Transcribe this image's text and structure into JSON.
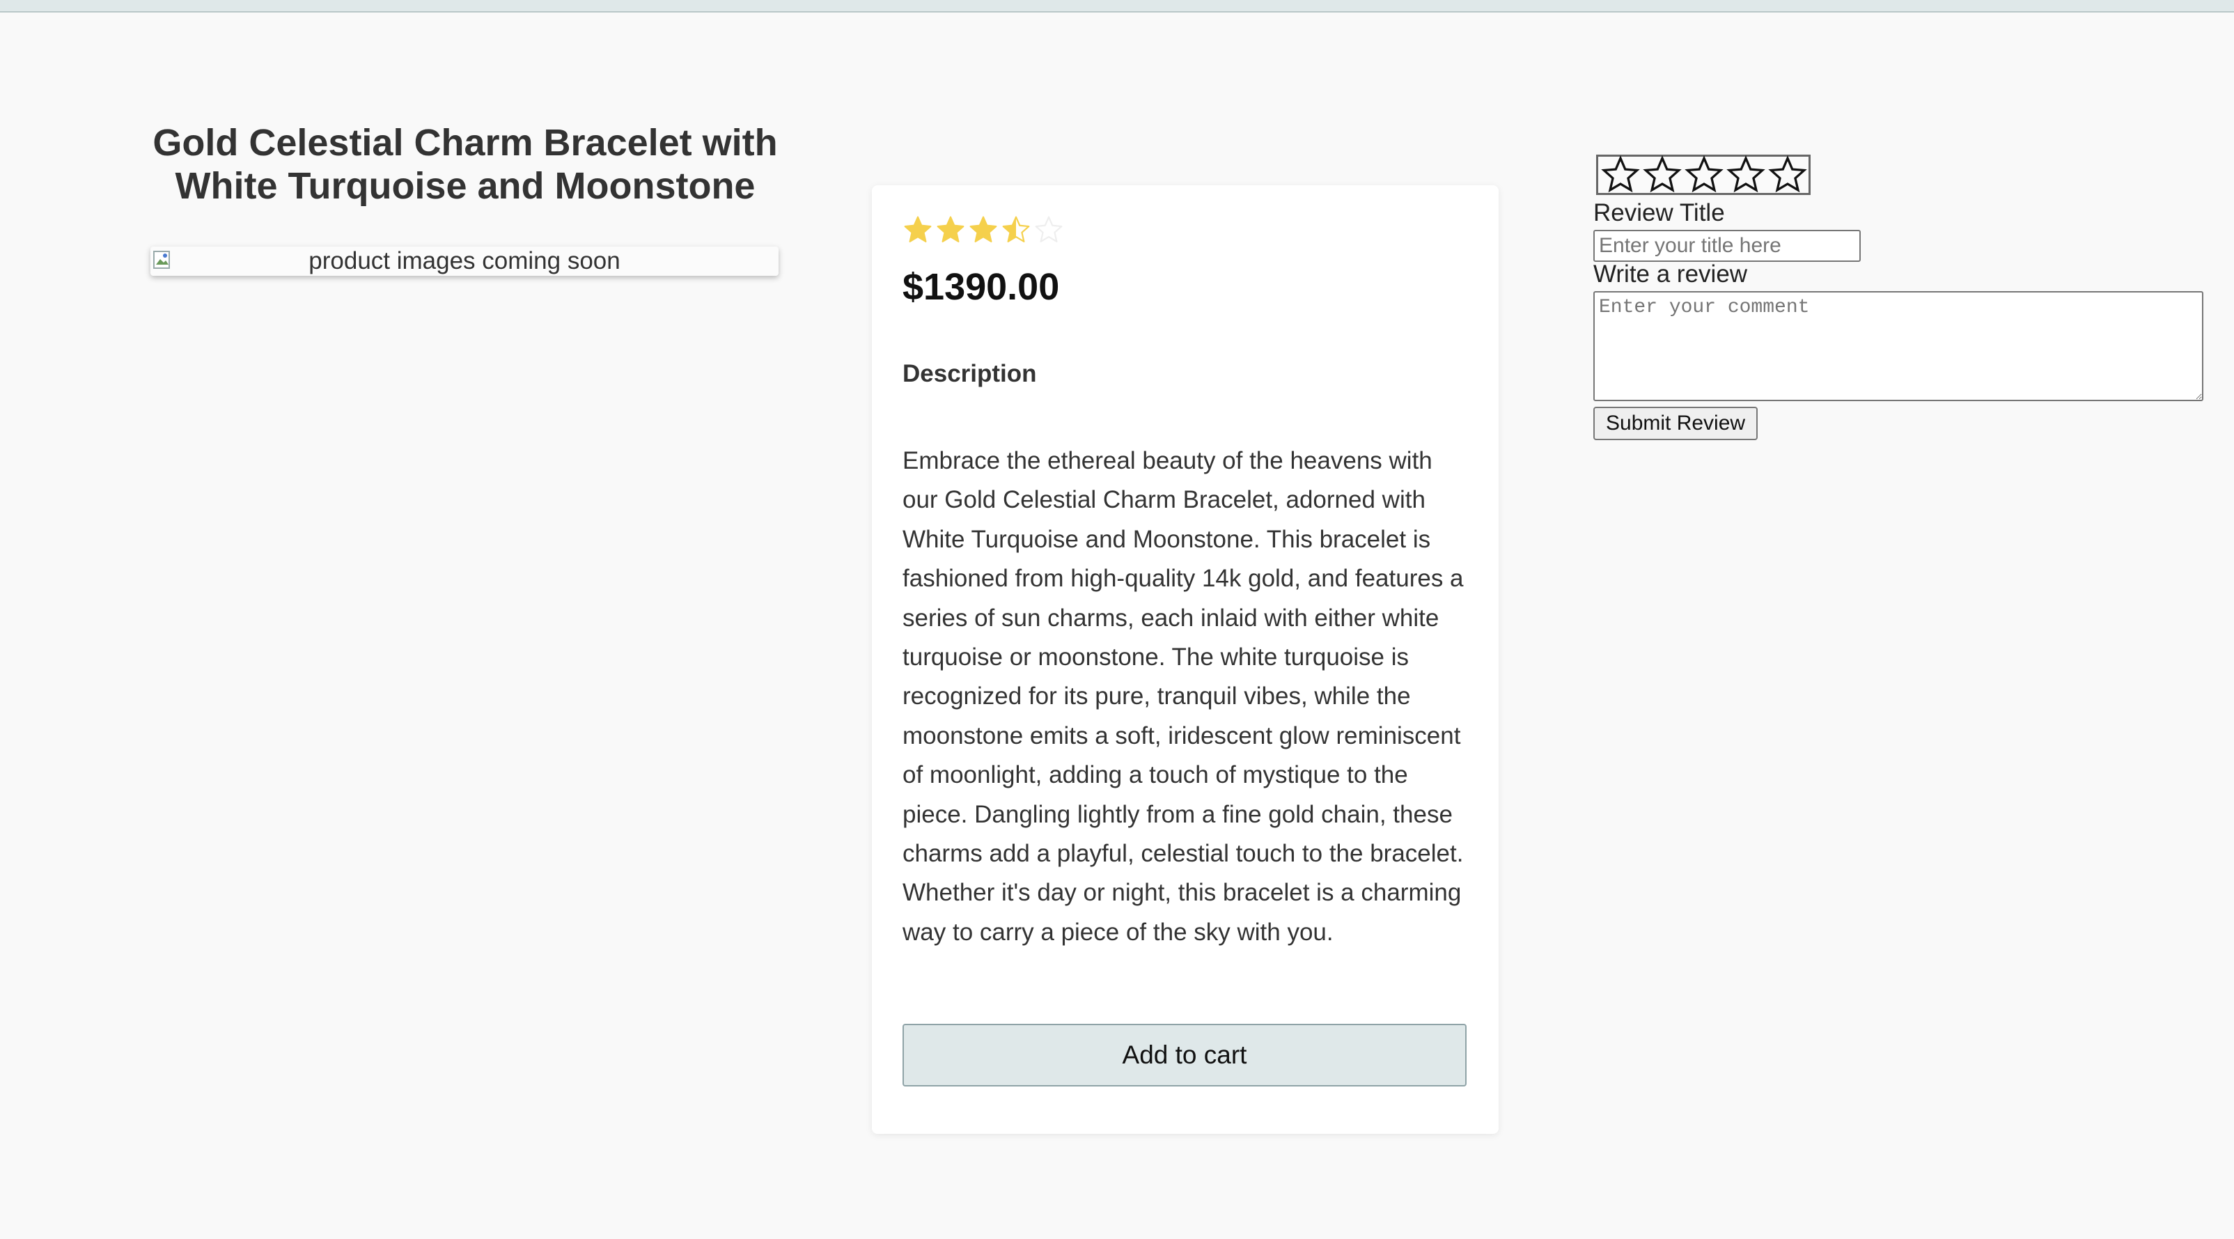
{
  "product": {
    "title": "Gold Celestial Charm Bracelet with White Turquoise and Moonstone",
    "image_alt": "product images coming soon",
    "rating": 3.5,
    "rating_max": 5,
    "price": "$1390.00",
    "description_heading": "Description",
    "description": "Embrace the ethereal beauty of the heavens with our Gold Celestial Charm Bracelet, adorned with White Turquoise and Moonstone. This bracelet is fashioned from high-quality 14k gold, and features a series of sun charms, each inlaid with either white turquoise or moonstone. The white turquoise is recognized for its pure, tranquil vibes, while the moonstone emits a soft, iridescent glow reminiscent of moonlight, adding a touch of mystique to the piece. Dangling lightly from a fine gold chain, these charms add a playful, celestial touch to the bracelet. Whether it's day or night, this bracelet is a charming way to carry a piece of the sky with you.",
    "add_to_cart_label": "Add to cart"
  },
  "review_form": {
    "star_count": 5,
    "title_label": "Review Title",
    "title_placeholder": "Enter your title here",
    "review_label": "Write a review",
    "comment_placeholder": "Enter your comment",
    "submit_label": "Submit Review"
  },
  "colors": {
    "star_filled": "#f5d04c",
    "star_empty": "#eeeeee",
    "accent_button": "#dfe8e9"
  }
}
